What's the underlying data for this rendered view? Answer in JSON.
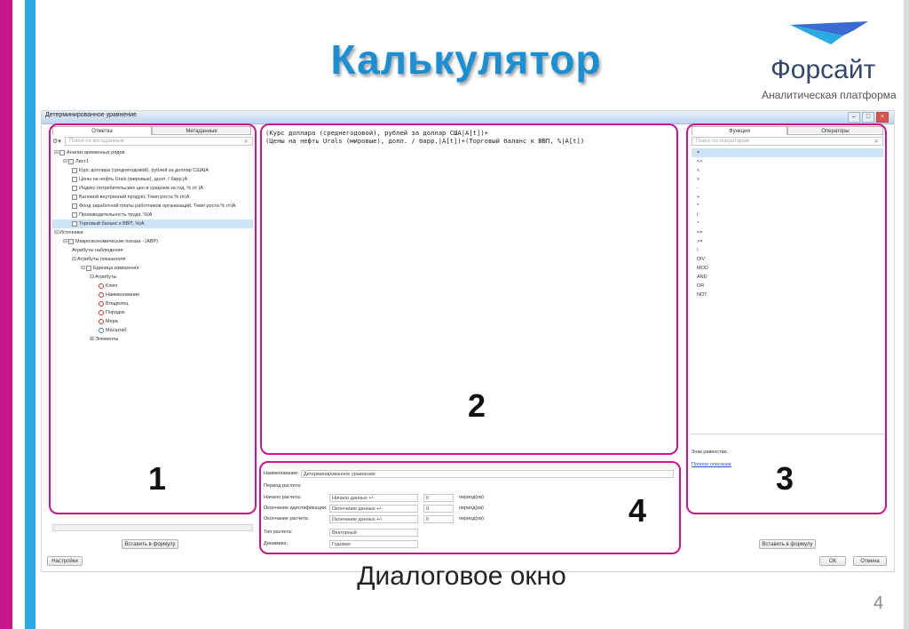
{
  "slide": {
    "title": "Калькулятор",
    "caption": "Диалоговое окно",
    "page_number": "4",
    "logo_name": "Форсайт",
    "logo_subtitle": "Аналитическая платформа",
    "accent_colors": {
      "magenta": "#c8168c",
      "cyan": "#29abe2",
      "title_blue": "#1a8fd4"
    }
  },
  "window": {
    "title": "Детерминированное уравнение",
    "controls": [
      "–",
      "□",
      "×"
    ]
  },
  "left_panel": {
    "tabs": [
      "Отметка",
      "Метаданные"
    ],
    "search_placeholder": "Поиск по метаданным",
    "tree": [
      {
        "level": 0,
        "exp": "⊟",
        "icon": "check",
        "label": "Анализ временных рядов"
      },
      {
        "level": 1,
        "exp": "⊟",
        "icon": "folder",
        "label": "Лист1"
      },
      {
        "level": 2,
        "exp": "",
        "icon": "series",
        "label": "Курс доллара (среднегодовой), рублей за доллар США|A"
      },
      {
        "level": 2,
        "exp": "",
        "icon": "series",
        "label": "Цены на нефть Urals (мировые), долл. / барр.|A"
      },
      {
        "level": 2,
        "exp": "",
        "icon": "series",
        "label": "Индекс потребительских цен в среднем за год, % г/г |A"
      },
      {
        "level": 2,
        "exp": "",
        "icon": "series",
        "label": "Валовой внутренний продукт, Темп роста % г/г|A"
      },
      {
        "level": 2,
        "exp": "",
        "icon": "series",
        "label": "Фонд заработной платы работников организаций, Темп роста % г/г|A"
      },
      {
        "level": 2,
        "exp": "",
        "icon": "series",
        "label": "Производительность труда, %|A"
      },
      {
        "level": 2,
        "exp": "",
        "icon": "series",
        "label": "Торговый баланс к ВВП, %|A",
        "selected": true
      },
      {
        "level": 0,
        "exp": "⊟",
        "icon": "none",
        "label": "Источники"
      },
      {
        "level": 1,
        "exp": "⊟",
        "icon": "db",
        "label": "Макроэкономические показа - (АВР)"
      },
      {
        "level": 2,
        "exp": "",
        "icon": "none",
        "label": "Атрибуты наблюдения"
      },
      {
        "level": 2,
        "exp": "⊟",
        "icon": "none",
        "label": "Атрибуты показателя"
      },
      {
        "level": 3,
        "exp": "⊟",
        "icon": "dict",
        "label": "Единица измерения"
      },
      {
        "level": 4,
        "exp": "⊟",
        "icon": "none",
        "label": "Атрибуты"
      },
      {
        "level": 5,
        "exp": "",
        "icon": "red",
        "label": "Ключ"
      },
      {
        "level": 5,
        "exp": "",
        "icon": "red",
        "label": "Наименование"
      },
      {
        "level": 5,
        "exp": "",
        "icon": "red",
        "label": "Владелец"
      },
      {
        "level": 5,
        "exp": "",
        "icon": "red",
        "label": "Порядок"
      },
      {
        "level": 5,
        "exp": "",
        "icon": "red",
        "label": "Мера"
      },
      {
        "level": 5,
        "exp": "",
        "icon": "blue",
        "label": "Масштаб"
      },
      {
        "level": 4,
        "exp": "⊞",
        "icon": "none",
        "label": "Элементы"
      }
    ],
    "insert_button": "Вставить в формулу"
  },
  "editor": {
    "lines": [
      "(Курс доллара (среднегодовой), рублей за доллар США|A[t])+",
      "(Цены на нефть Urals (мировые), долл. / барр.|A[t])+(Торговый баланс к ВВП, %|A[t])"
    ]
  },
  "params": {
    "name_label": "Наименование:",
    "name_value": "Детерминированное уравнение",
    "period_label": "Период расчета:",
    "rows": [
      {
        "label": "Начало расчета:",
        "value": "Начало данных +/-",
        "num": "0",
        "unit": "период(ов)"
      },
      {
        "label": "Окончание идентификации:",
        "value": "Окончание данных +/-",
        "num": "0",
        "unit": "период(ов)"
      },
      {
        "label": "Окончание расчета:",
        "value": "Окончание данных +/-",
        "num": "0",
        "unit": "период(ов)"
      }
    ],
    "calc_type_label": "Тип расчета:",
    "calc_type_value": "Векторный",
    "dynamics_label": "Динамика:",
    "dynamics_value": "Годовая"
  },
  "right_panel": {
    "tabs": [
      "Функции",
      "Операторы"
    ],
    "search_placeholder": "Поиск по операторам",
    "operators": [
      "=",
      "<>",
      "<",
      ">",
      "-",
      "+",
      "*",
      "/",
      "^",
      "<=",
      ">=",
      "\\",
      "DIV",
      "MOD",
      "AND",
      "OR",
      "NOT"
    ],
    "desc_text": "Знак равенства.",
    "desc_link": "Полное описание",
    "insert_button": "Вставить в формулу"
  },
  "footer": {
    "settings_button": "Настройки",
    "ok_button": "ОК",
    "cancel_button": "Отмена"
  },
  "callouts": [
    "1",
    "2",
    "3",
    "4"
  ]
}
